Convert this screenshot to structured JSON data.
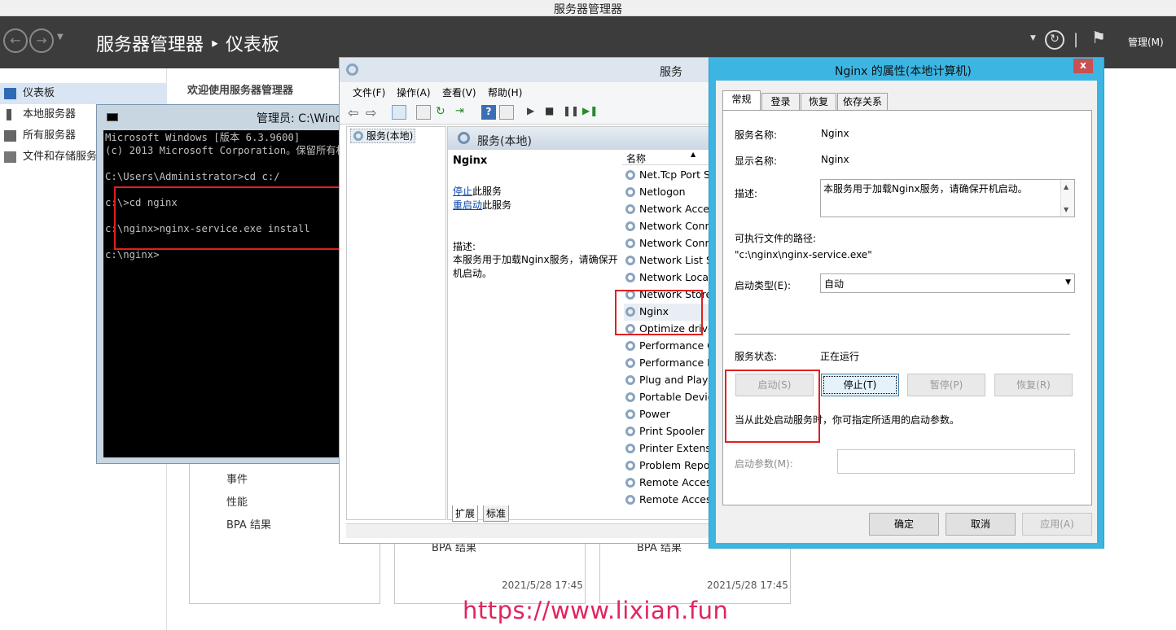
{
  "server_manager": {
    "window_title": "服务器管理器",
    "breadcrumb": "服务器管理器 ‣ 仪表板",
    "manage_menu": "管理(M)",
    "sidebar": [
      {
        "label": "仪表板"
      },
      {
        "label": "本地服务器"
      },
      {
        "label": "所有服务器"
      },
      {
        "label": "文件和存储服务"
      }
    ],
    "welcome": "欢迎使用服务器管理器",
    "tile1_rows": [
      "事件",
      "性能",
      "BPA 结果"
    ],
    "tile_bpa": "BPA 结果",
    "tile_date": "2021/5/28 17:45"
  },
  "cmd": {
    "title": "管理员: C:\\Windows\\system32\\cmd.exe",
    "lines": [
      "Microsoft Windows [版本 6.3.9600]",
      "(c) 2013 Microsoft Corporation。保留所有权利。",
      "",
      "C:\\Users\\Administrator>cd c:/",
      "",
      "c:\\>cd nginx",
      "",
      "c:\\nginx>nginx-service.exe install",
      "",
      "c:\\nginx>"
    ]
  },
  "services": {
    "title": "服务",
    "menus": [
      "文件(F)",
      "操作(A)",
      "查看(V)",
      "帮助(H)"
    ],
    "tree_node": "服务(本地)",
    "panel_header": "服务(本地)",
    "selected_name": "Nginx",
    "stop_link": "停止",
    "stop_suffix": "此服务",
    "restart_link": "重启动",
    "restart_suffix": "此服务",
    "desc_label": "描述:",
    "desc_text": "本服务用于加载Nginx服务，请确保开机启动。",
    "column_name": "名称",
    "rows": [
      "Net.Tcp Port Sharing Service",
      "Netlogon",
      "Network Access Protection Agent",
      "Network Connections",
      "Network Connectivity Assistant",
      "Network List Service",
      "Network Location Awareness",
      "Network Store Interface Service",
      "Nginx",
      "Optimize drives",
      "Performance Counter DLL Host",
      "Performance Logs & Alerts",
      "Plug and Play",
      "Portable Device Enumerator Service",
      "Power",
      "Print Spooler",
      "Printer Extensions and Notifications",
      "Problem Reports and Solutions Control Panel Support",
      "Remote Access Auto Connection Manager",
      "Remote Access Connection Manager"
    ],
    "tab_extended": "扩展",
    "tab_standard": "标准"
  },
  "props": {
    "title": "Nginx 的属性(本地计算机)",
    "close": "x",
    "tabs": [
      "常规",
      "登录",
      "恢复",
      "依存关系"
    ],
    "service_name_label": "服务名称:",
    "service_name": "Nginx",
    "display_name_label": "显示名称:",
    "display_name": "Nginx",
    "desc_label": "描述:",
    "desc": "本服务用于加载Nginx服务，请确保开机启动。",
    "path_label": "可执行文件的路径:",
    "path": "\"c:\\nginx\\nginx-service.exe\"",
    "startup_type_label": "启动类型(E):",
    "startup_type": "自动",
    "status_label": "服务状态:",
    "status": "正在运行",
    "btn_start": "启动(S)",
    "btn_stop": "停止(T)",
    "btn_pause": "暂停(P)",
    "btn_resume": "恢复(R)",
    "hint": "当从此处启动服务时，你可指定所适用的启动参数。",
    "params_label": "启动参数(M):",
    "params_value": "",
    "ok": "确定",
    "cancel": "取消",
    "apply": "应用(A)"
  },
  "watermark": "https://www.lixian.fun",
  "colors": {
    "header_bg": "#3c3c3c",
    "dialog_frame": "#3cb5e2",
    "highlight_red": "#e02020",
    "watermark": "#e0245e"
  }
}
